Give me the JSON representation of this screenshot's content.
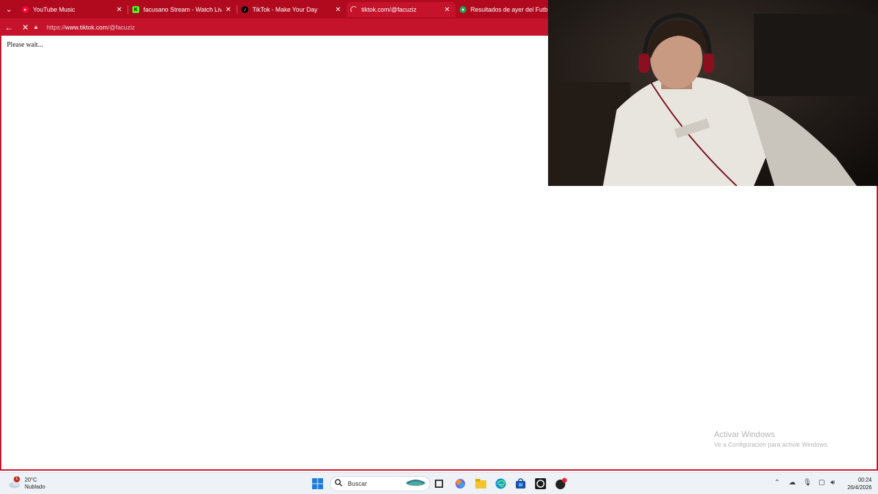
{
  "browser": {
    "tabs": [
      {
        "title": "YouTube Music",
        "icon": "youtube-music-icon",
        "color": "#ff0033"
      },
      {
        "title": "facusano Stream - Watch Live on K",
        "icon": "kick-icon",
        "color": "#53fc18"
      },
      {
        "title": "TikTok - Make Your Day",
        "icon": "tiktok-icon",
        "color": "#000000"
      },
      {
        "title": "tiktok.com/@facuziz",
        "icon": "loading-spinner-icon",
        "color": "#ffffff"
      },
      {
        "title": "Resultados de ayer del Futbol Ar",
        "icon": "chrome-like-icon",
        "color": "#22a352"
      }
    ],
    "address": {
      "scheme": "https://",
      "host": "www.tiktok.com",
      "path": "/@facuziz"
    },
    "accent": "#c4132b"
  },
  "page": {
    "message": "Please wait..."
  },
  "watermark": {
    "title": "Activar Windows",
    "subtitle": "Ve a Configuración para activar Windows."
  },
  "taskbar": {
    "weather": {
      "temp": "20°C",
      "condition": "Nublado",
      "badge": "1"
    },
    "search_placeholder": "Buscar",
    "clock": {
      "time": "00:24",
      "date": "26/4/2026"
    }
  }
}
